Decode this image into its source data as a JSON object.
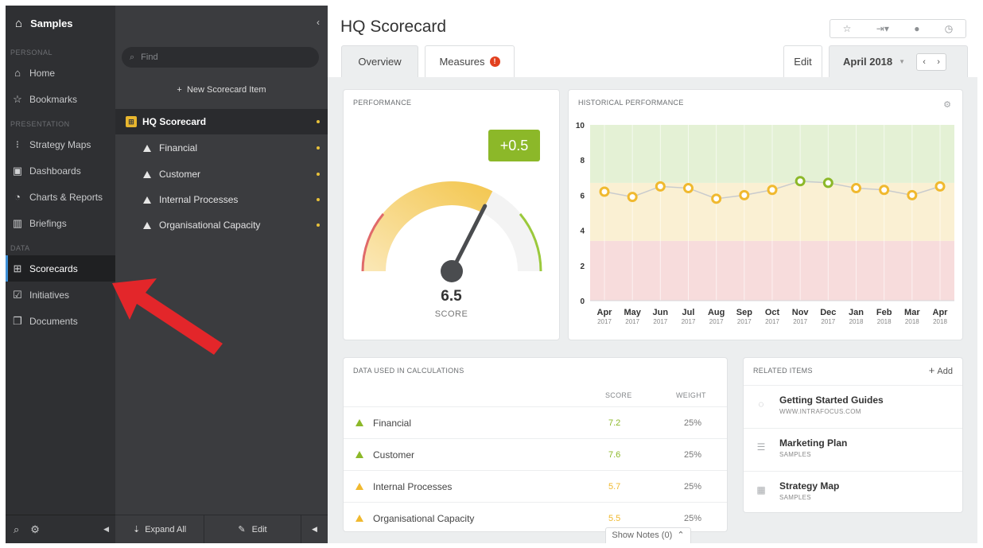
{
  "nav": {
    "brand": "Samples",
    "sections": {
      "personal": "PERSONAL",
      "presentation": "PRESENTATION",
      "data": "DATA"
    },
    "items": [
      {
        "label": "Home",
        "icon": "home-icon"
      },
      {
        "label": "Bookmarks",
        "icon": "star-icon"
      },
      {
        "label": "Strategy Maps",
        "icon": "strategy-map-icon"
      },
      {
        "label": "Dashboards",
        "icon": "dashboard-icon"
      },
      {
        "label": "Charts & Reports",
        "icon": "chart-icon"
      },
      {
        "label": "Briefings",
        "icon": "book-icon"
      },
      {
        "label": "Scorecards",
        "icon": "scorecard-icon",
        "active": true
      },
      {
        "label": "Initiatives",
        "icon": "checkbox-icon"
      },
      {
        "label": "Documents",
        "icon": "document-icon"
      }
    ]
  },
  "tree": {
    "find_placeholder": "Find",
    "new_item": "New Scorecard Item",
    "rows": [
      {
        "label": "HQ Scorecard",
        "selected": true
      },
      {
        "label": "Financial"
      },
      {
        "label": "Customer"
      },
      {
        "label": "Internal Processes"
      },
      {
        "label": "Organisational Capacity"
      }
    ],
    "expand_all": "Expand All",
    "edit": "Edit"
  },
  "main": {
    "title": "HQ Scorecard",
    "tabs": {
      "overview": "Overview",
      "measures": "Measures",
      "measures_badge": "!"
    },
    "edit": "Edit",
    "period": "April 2018"
  },
  "performance": {
    "title": "PERFORMANCE",
    "delta": "+0.5",
    "score": "6.5",
    "score_label": "SCORE",
    "gauge_value": 6.5,
    "gauge_max": 10
  },
  "historical": {
    "title": "HISTORICAL PERFORMANCE"
  },
  "chart_data": {
    "type": "line",
    "title": "HISTORICAL PERFORMANCE",
    "x": [
      "Apr 2017",
      "May 2017",
      "Jun 2017",
      "Jul 2017",
      "Aug 2017",
      "Sep 2017",
      "Oct 2017",
      "Nov 2017",
      "Dec 2017",
      "Jan 2018",
      "Feb 2018",
      "Mar 2018",
      "Apr 2018"
    ],
    "x_month": [
      "Apr",
      "May",
      "Jun",
      "Jul",
      "Aug",
      "Sep",
      "Oct",
      "Nov",
      "Dec",
      "Jan",
      "Feb",
      "Mar",
      "Apr"
    ],
    "x_year": [
      "2017",
      "2017",
      "2017",
      "2017",
      "2017",
      "2017",
      "2017",
      "2017",
      "2017",
      "2018",
      "2018",
      "2018",
      "2018"
    ],
    "series": [
      {
        "values": [
          6.2,
          5.9,
          6.5,
          6.4,
          5.8,
          6.0,
          6.3,
          6.8,
          6.7,
          6.4,
          6.3,
          6.0,
          6.5
        ],
        "point_status": [
          "amber",
          "amber",
          "amber",
          "amber",
          "amber",
          "amber",
          "amber",
          "green",
          "green",
          "amber",
          "amber",
          "amber",
          "amber"
        ]
      }
    ],
    "ylim": [
      0,
      10
    ],
    "yticks": [
      "0",
      "2",
      "4",
      "6",
      "8",
      "10"
    ],
    "bands": [
      {
        "from": 0,
        "to": 3.4,
        "color": "#f7dcdc"
      },
      {
        "from": 3.4,
        "to": 6.7,
        "color": "#faf0d3"
      },
      {
        "from": 6.7,
        "to": 10,
        "color": "#e4f1d5"
      }
    ],
    "colors": {
      "amber": "#f0b92f",
      "green": "#8cb829",
      "line": "#c9cbcd"
    }
  },
  "calc": {
    "title": "DATA USED IN CALCULATIONS",
    "col_score": "SCORE",
    "col_weight": "WEIGHT",
    "rows": [
      {
        "label": "Financial",
        "score": "7.2",
        "weight": "25%",
        "status": "green"
      },
      {
        "label": "Customer",
        "score": "7.6",
        "weight": "25%",
        "status": "green"
      },
      {
        "label": "Internal Processes",
        "score": "5.7",
        "weight": "25%",
        "status": "amber"
      },
      {
        "label": "Organisational Capacity",
        "score": "5.5",
        "weight": "25%",
        "status": "amber"
      }
    ]
  },
  "related": {
    "title": "RELATED ITEMS",
    "add": "Add",
    "items": [
      {
        "name": "Getting Started Guides",
        "sub": "WWW.INTRAFOCUS.COM",
        "icon": "globe-icon"
      },
      {
        "name": "Marketing Plan",
        "sub": "SAMPLES",
        "icon": "list-icon"
      },
      {
        "name": "Strategy Map",
        "sub": "SAMPLES",
        "icon": "strategy-map-icon"
      }
    ]
  },
  "notes": {
    "label": "Show Notes (0)"
  },
  "colors": {
    "accent_green": "#8cb829",
    "accent_amber": "#f0b92f",
    "nav_bg": "#2f3033",
    "annotation": "#e3262a"
  }
}
